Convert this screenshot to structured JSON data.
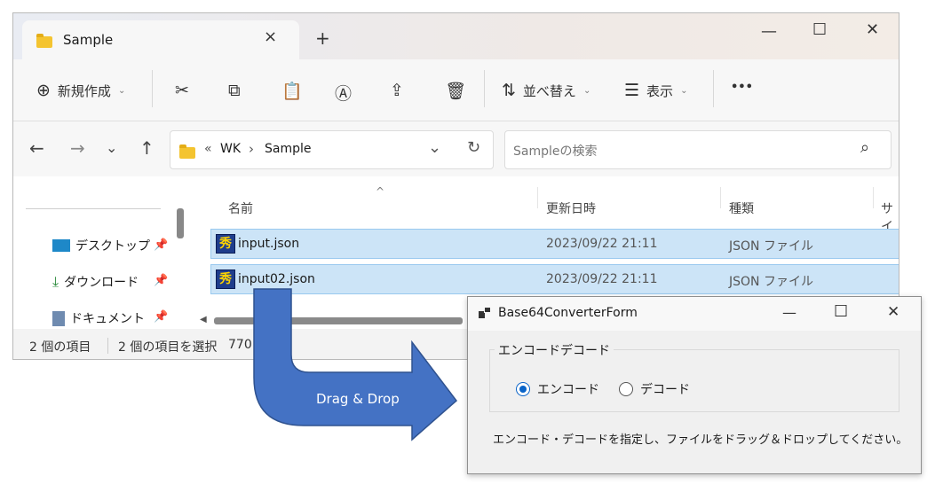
{
  "explorer": {
    "tab_title": "Sample",
    "tab_close": "×",
    "new_tab": "+",
    "window_controls": {
      "minimize": "—",
      "maximize": "☐",
      "close": "✕"
    },
    "toolbar": {
      "new_label": "新規作成",
      "sort_label": "並べ替え",
      "view_label": "表示",
      "more": "•••",
      "icons": [
        "cut-icon",
        "copy-icon",
        "paste-icon",
        "rename-icon",
        "share-icon",
        "delete-icon"
      ]
    },
    "nav": {
      "back": "←",
      "forward": "→",
      "recent": "⌄",
      "up": "↑"
    },
    "address": {
      "prefix": "«",
      "path1": "WK",
      "arrow": "›",
      "path2": "Sample",
      "dropdown": "⌄",
      "refresh": "↻"
    },
    "search": {
      "placeholder": "Sampleの検索",
      "icon": "⌕"
    },
    "sidebar": [
      {
        "label": "デスクトップ",
        "icon": "desktop-icon"
      },
      {
        "label": "ダウンロード",
        "icon": "download-icon"
      },
      {
        "label": "ドキュメント",
        "icon": "document-icon"
      }
    ],
    "columns": {
      "name": "名前",
      "date": "更新日時",
      "type": "種類",
      "size": "サイ"
    },
    "files": [
      {
        "name": "input.json",
        "date": "2023/09/22 21:11",
        "type": "JSON ファイル"
      },
      {
        "name": "input02.json",
        "date": "2023/09/22 21:11",
        "type": "JSON ファイル"
      }
    ],
    "status": {
      "count": "2 個の項目",
      "selected": "2 個の項目を選択",
      "size": "770"
    }
  },
  "arrow": {
    "label": "Drag & Drop",
    "color": "#4472c4"
  },
  "form": {
    "title": "Base64ConverterForm",
    "window_controls": {
      "minimize": "—",
      "maximize": "☐",
      "close": "✕"
    },
    "group_title": "エンコードデコード",
    "radio_encode": "エンコード",
    "radio_decode": "デコード",
    "selected": "encode",
    "instruction": "エンコード・デコードを指定し、ファイルをドラッグ＆ドロップしてください。"
  }
}
